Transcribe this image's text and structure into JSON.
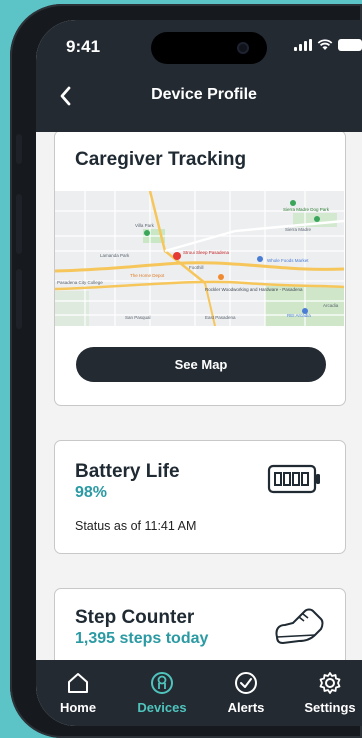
{
  "status_bar": {
    "time": "9:41"
  },
  "header": {
    "title": "Device Profile"
  },
  "cards": {
    "tracking": {
      "title": "Caregiver Tracking",
      "button_label": "See Map",
      "map_labels": {
        "place1": "Villa Park",
        "place2": "Sierra Madre Dog Park",
        "place3": "Sierra Madre",
        "place4": "Whole Foods Market",
        "place5": "The Home Depot",
        "place6": "Pasadena City College",
        "place7": "San Pasqual",
        "place8": "East Pasadena",
        "place9": "Arcadia",
        "place10": "Foothill",
        "place11": "Lamanda Park",
        "place12": "Rockler Woodworking and Hardware - Pasadena",
        "place13": "REI Arcadia",
        "place14": "Stroui Sleep Pasadena"
      }
    },
    "battery": {
      "title": "Battery Life",
      "value": "98%",
      "status": "Status as of 11:41 AM"
    },
    "steps": {
      "title": "Step Counter",
      "value": "1,395 steps today"
    }
  },
  "tabs": [
    {
      "label": "Home",
      "icon": "home-icon",
      "active": false
    },
    {
      "label": "Devices",
      "icon": "devices-icon",
      "active": true
    },
    {
      "label": "Alerts",
      "icon": "check-circle-icon",
      "active": false
    },
    {
      "label": "Settings",
      "icon": "gear-icon",
      "active": false
    }
  ],
  "colors": {
    "dark": "#232a32",
    "accent": "#2b9aa3",
    "tab_active": "#4fc4bd",
    "background": "#5cc3c6"
  }
}
